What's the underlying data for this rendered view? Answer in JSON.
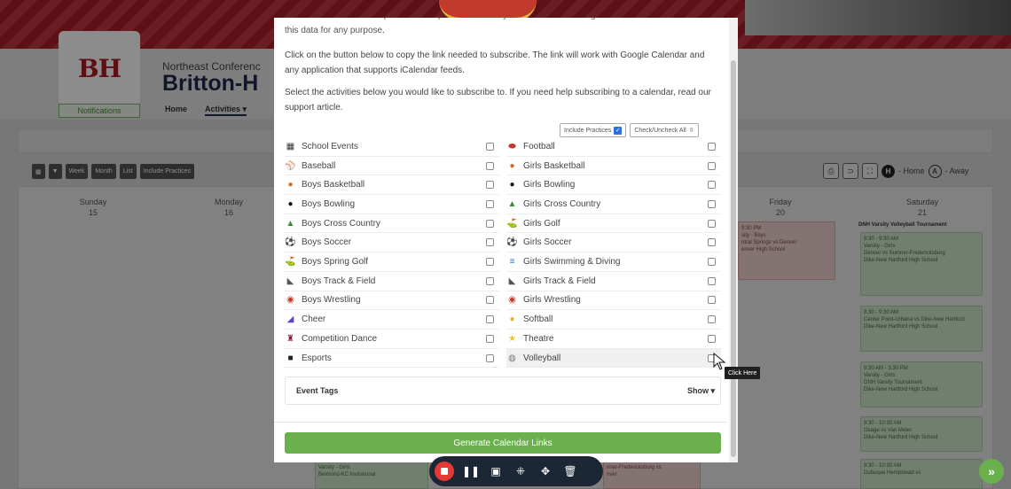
{
  "background": {
    "logo_text": "BH",
    "conference": "Northeast Conferenc",
    "school_name": "Britton-H",
    "notifications_label": "Notifications",
    "nav": [
      "Home",
      "Activities ▾"
    ],
    "toolbar": [
      "Week",
      "Month",
      "List",
      "Include Practices"
    ],
    "home_legend": "- Home",
    "away_legend": "- Away",
    "days": [
      {
        "name": "Sunday",
        "num": "15"
      },
      {
        "name": "Monday",
        "num": "16"
      },
      {
        "name": "Friday",
        "num": "20"
      },
      {
        "name": "Saturday",
        "num": "21"
      }
    ],
    "tournament_title": "DNH Varsity Volleyball Tournament",
    "friday_event": [
      "9:30 PM",
      "sity - Boys",
      "ntral Springs vs Denver",
      "enver High School"
    ],
    "saturday_events": [
      [
        "8:30 - 9:30 AM",
        "Varsity - Girls",
        "Denver vs Sumner-Fredericksburg",
        "Dike-New Hartford High School"
      ],
      [
        "8:30 - 9:30 AM",
        "Center Point-Urbana vs Dike-New Hartford",
        "Dike-New Hartford High School"
      ],
      [
        "8:30 AM - 3:30 PM",
        "Varsity - Girls",
        "DNH Varsity Tournament",
        "Dike-New Hartford High School"
      ],
      [
        "9:30 - 10:30 AM",
        "Osage vs Van Meter",
        "Dike-New Hartford High School"
      ],
      [
        "9:30 - 10:30 AM",
        "Dubuque Hempstead vs"
      ]
    ],
    "bottom_event_left": [
      "Varsity - Girls",
      "Belmond-KC Invitational"
    ],
    "bottom_event_mid": [
      "nner-Fredericksburg vs",
      "nver"
    ]
  },
  "modal": {
    "clipped_text": "The data in these subscriptions are for personal use only. No businesses or organizations are allowed to use this data for any purpose.",
    "intro_text": "Click on the button below to copy the link needed to subscribe. The link will work with Google Calendar and any application that supports iCalendar feeds.",
    "select_text": "Select the activities below you would like to subscribe to. If you need help subscribing to a calendar, read our support article.",
    "include_practices_label": "Include Practices",
    "check_all_label": "Check/Uncheck All",
    "left_activities": [
      {
        "label": "School Events",
        "icon": "school-icon",
        "symbol": "▦",
        "color": "#333333"
      },
      {
        "label": "Baseball",
        "icon": "baseball-icon",
        "symbol": "⚾",
        "color": "#e05050"
      },
      {
        "label": "Boys Basketball",
        "icon": "basketball-icon",
        "symbol": "●",
        "color": "#d2691e"
      },
      {
        "label": "Boys Bowling",
        "icon": "bowling-icon",
        "symbol": "●",
        "color": "#111111"
      },
      {
        "label": "Boys Cross Country",
        "icon": "cross-country-icon",
        "symbol": "▲",
        "color": "#3a8a3a"
      },
      {
        "label": "Boys Soccer",
        "icon": "soccer-icon",
        "symbol": "⚽",
        "color": "#222222"
      },
      {
        "label": "Boys Spring Golf",
        "icon": "golf-icon",
        "symbol": "⛳",
        "color": "#3a8a3a"
      },
      {
        "label": "Boys Track & Field",
        "icon": "track-icon",
        "symbol": "◣",
        "color": "#555555"
      },
      {
        "label": "Boys Wrestling",
        "icon": "wrestling-icon",
        "symbol": "◉",
        "color": "#c0392b"
      },
      {
        "label": "Cheer",
        "icon": "cheer-icon",
        "symbol": "◢",
        "color": "#5b3fd1"
      },
      {
        "label": "Competition Dance",
        "icon": "dance-icon",
        "symbol": "♜",
        "color": "#8b1a3a"
      },
      {
        "label": "Esports",
        "icon": "gamepad-icon",
        "symbol": "■",
        "color": "#222222"
      }
    ],
    "right_activities": [
      {
        "label": "Football",
        "icon": "football-icon",
        "symbol": "⬬",
        "color": "#c0392b"
      },
      {
        "label": "Girls Basketball",
        "icon": "basketball-icon",
        "symbol": "●",
        "color": "#d2691e"
      },
      {
        "label": "Girls Bowling",
        "icon": "bowling-icon",
        "symbol": "●",
        "color": "#111111"
      },
      {
        "label": "Girls Cross Country",
        "icon": "cross-country-icon",
        "symbol": "▲",
        "color": "#3a8a3a"
      },
      {
        "label": "Girls Golf",
        "icon": "golf-icon",
        "symbol": "⛳",
        "color": "#3a8a3a"
      },
      {
        "label": "Girls Soccer",
        "icon": "soccer-icon",
        "symbol": "⚽",
        "color": "#222222"
      },
      {
        "label": "Girls Swimming & Diving",
        "icon": "swimming-icon",
        "symbol": "≡",
        "color": "#2f6fd8"
      },
      {
        "label": "Girls Track & Field",
        "icon": "track-icon",
        "symbol": "◣",
        "color": "#555555"
      },
      {
        "label": "Girls Wrestling",
        "icon": "wrestling-icon",
        "symbol": "◉",
        "color": "#c0392b"
      },
      {
        "label": "Softball",
        "icon": "softball-icon",
        "symbol": "●",
        "color": "#e0b43a"
      },
      {
        "label": "Theatre",
        "icon": "star-icon",
        "symbol": "★",
        "color": "#f0c020"
      },
      {
        "label": "Volleyball",
        "icon": "volleyball-icon",
        "symbol": "◍",
        "color": "#777777"
      }
    ],
    "event_tags_label": "Event Tags",
    "show_label": "Show ▾",
    "generate_label": "Generate Calendar Links"
  },
  "tooltip": "Click Here",
  "colors": {
    "accent_green": "#6ab04c",
    "brand_red": "#b8202a",
    "checkbox_blue": "#2f6fd8"
  }
}
